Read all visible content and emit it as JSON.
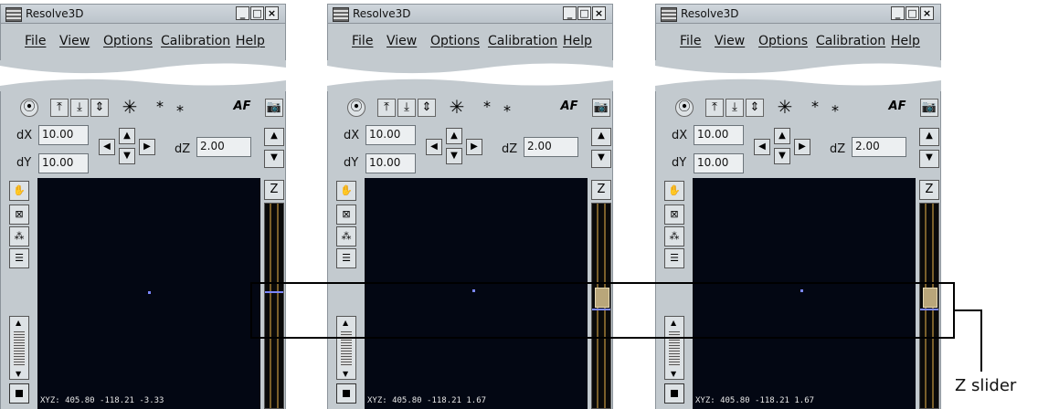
{
  "windows": [
    {
      "title": "Resolve3D",
      "menu": [
        "File",
        "View",
        "Options",
        "Calibration",
        "Help"
      ],
      "dx_label": "dX",
      "dx_value": "10.00",
      "dy_label": "dY",
      "dy_value": "10.00",
      "dz_label": "dZ",
      "dz_value": "2.00",
      "af_label": "AF",
      "z_label": "Z",
      "readout": "XYZ: 405.80 -118.21 -3.33",
      "z_slider_fraction": null
    },
    {
      "title": "Resolve3D",
      "menu": [
        "File",
        "View",
        "Options",
        "Calibration",
        "Help"
      ],
      "dx_label": "dX",
      "dx_value": "10.00",
      "dy_label": "dY",
      "dy_value": "10.00",
      "dz_label": "dZ",
      "dz_value": "2.00",
      "af_label": "AF",
      "z_label": "Z",
      "readout": "XYZ: 405.80 -118.21 1.67",
      "z_slider_fraction": 0.42
    },
    {
      "title": "Resolve3D",
      "menu": [
        "File",
        "View",
        "Options",
        "Calibration",
        "Help"
      ],
      "dx_label": "dX",
      "dx_value": "10.00",
      "dy_label": "dY",
      "dy_value": "10.00",
      "dz_label": "dZ",
      "dz_value": "2.00",
      "af_label": "AF",
      "z_label": "Z",
      "readout": "XYZ: 405.80 -118.21 1.67",
      "z_slider_fraction": 0.42
    }
  ],
  "callout": {
    "label": "Z slider"
  },
  "colors": {
    "canvas": "#030713",
    "panel": "#c3cacf",
    "focus_dot": "#7b87ff",
    "z_thumb": "#b9a67a"
  }
}
